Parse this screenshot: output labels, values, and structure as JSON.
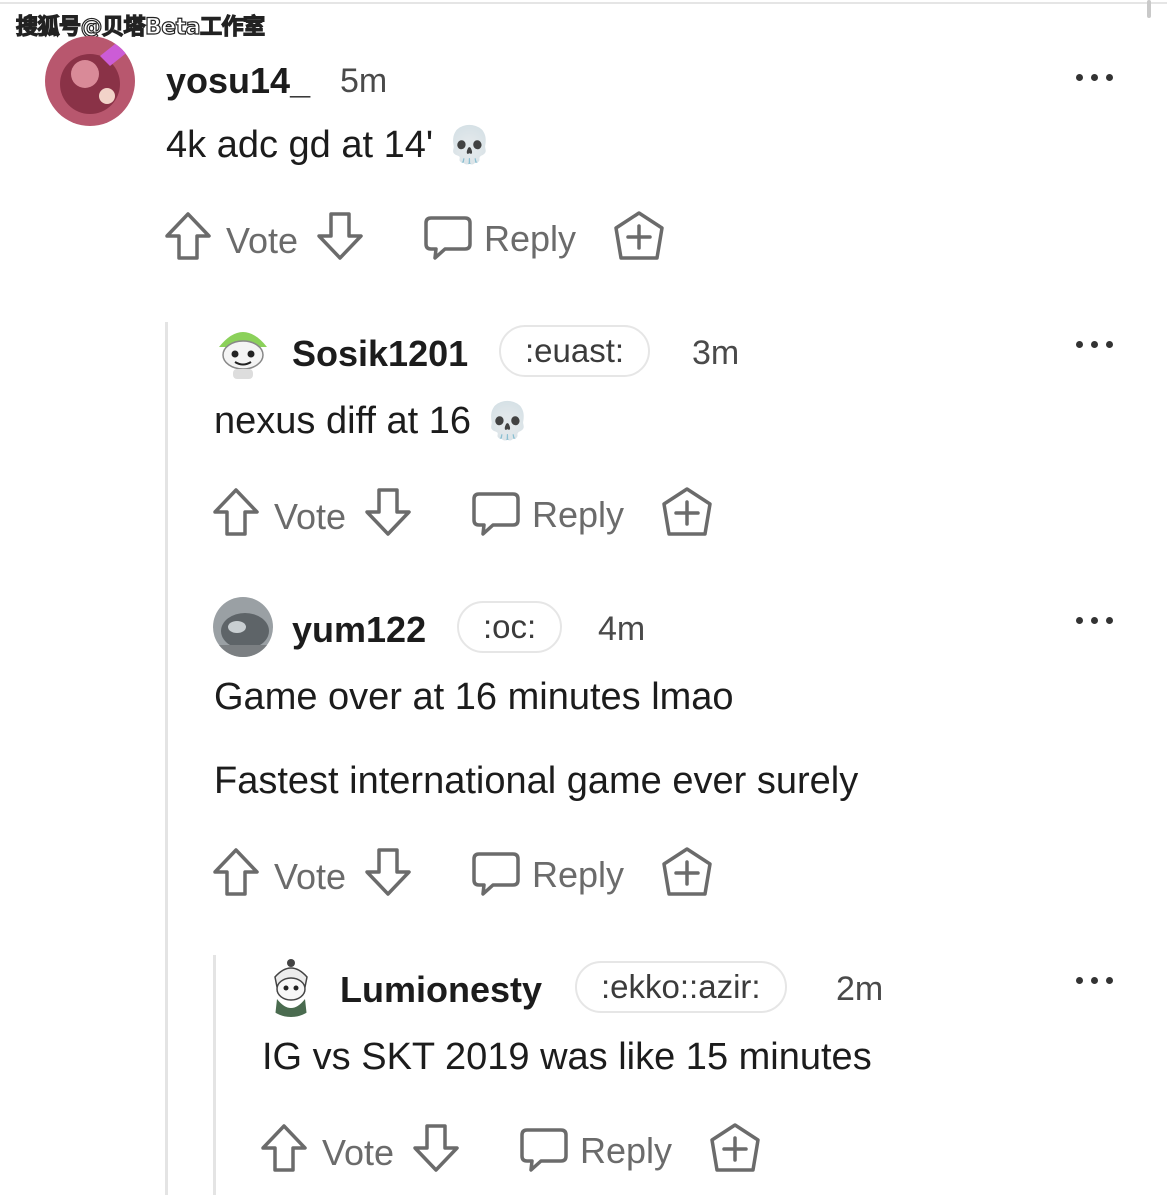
{
  "watermark": "搜狐号@贝塔Beta工作室",
  "comments": [
    {
      "username": "yosu14_",
      "flair": "",
      "time": "5m",
      "body": [
        "4k adc gd at 14'"
      ],
      "emoji": "💀",
      "avatar_color": "#c86a7a",
      "actions": {
        "vote": "Vote",
        "reply": "Reply"
      }
    },
    {
      "username": "Sosik1201",
      "flair": ":euast:",
      "time": "3m",
      "body": [
        "nexus diff at 16"
      ],
      "emoji": "💀",
      "avatar_color": "#8bd15a",
      "actions": {
        "vote": "Vote",
        "reply": "Reply"
      }
    },
    {
      "username": "yum122",
      "flair": ":oc:",
      "time": "4m",
      "body": [
        "Game over at 16 minutes lmao",
        "Fastest international game ever surely"
      ],
      "emoji": "",
      "avatar_color": "#6d7378",
      "actions": {
        "vote": "Vote",
        "reply": "Reply"
      }
    },
    {
      "username": "Lumionesty",
      "flair": ":ekko::azir:",
      "time": "2m",
      "body": [
        "IG vs SKT 2019 was like 15 minutes"
      ],
      "emoji": "",
      "avatar_color": "#4a6b4f",
      "actions": {
        "vote": "Vote",
        "reply": "Reply"
      }
    }
  ],
  "icons": {
    "upvote": "upvote-arrow-icon",
    "downvote": "downvote-arrow-icon",
    "reply": "speech-bubble-icon",
    "award": "award-plus-icon",
    "more": "more-options-icon"
  }
}
